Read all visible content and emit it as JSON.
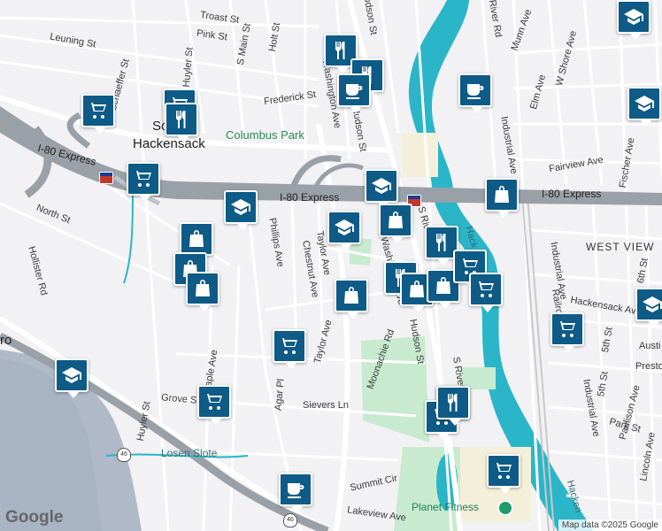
{
  "map": {
    "attribution": "Map data ©2025 Google",
    "logo": "Google",
    "colors": {
      "water": "#2ab6c8",
      "park": "#c8ebcf",
      "road": "#ffffff",
      "highway": "#9aa0a8",
      "land": "#f2f1f4",
      "poi": "#0d5b86"
    }
  },
  "labels": {
    "troast": "Troast St",
    "pink": "Pink St",
    "holt": "Holt St",
    "smain": "S Main St",
    "leuning": "Leuning St",
    "frederick": "Frederick St",
    "columbus": "Columbus Park",
    "south_hack_1": "Sou",
    "south_hack_2": "Hackensack",
    "i80_left": "I-80 Express",
    "i80_mid": "I-80 Express",
    "i80_right": "I-80 Express",
    "north": "North St",
    "hollister": "Hollister Rd",
    "phillips": "Phillips Ave",
    "chestnut": "Chestnut Ave",
    "taylor": "Taylor Ave",
    "taylor2": "Taylor Ave",
    "washington": "Washington Ave",
    "washington2": "Washington Ave",
    "hudson": "Hudson St",
    "hudson2": "Hudson St",
    "moonachie": "Moonachie Rd",
    "sriver": "S River",
    "sriver2": "S River",
    "huyler": "Huyler St",
    "huyler2": "Huyler St",
    "maple": "aple Ave",
    "grove": "Grove S",
    "agar": "Agar Pl",
    "sievers": "Sievers Ln",
    "losen": "Losen Slote",
    "summit": "Summit Cir",
    "lakeview": "Lakeview Ave",
    "planet": "Planet Fitness",
    "riverrd": "River Rd",
    "munn": "Munn Ave",
    "wshore": "W Shore Ave",
    "elm": "Elm Ave",
    "industrial": "Industrial Ave",
    "industrial2": "Industrial Ave",
    "industrial3": "Industrial Ave",
    "fairview": "Fairview Ave",
    "fischer": "Fischer Ave",
    "westview": "WEST VIEW",
    "hackensack_ave": "Hackensack Ave",
    "railroad": "Railro",
    "fifth1": "5th St",
    "fifth2": "5th St",
    "sixth": "6th St",
    "austin": "Austi",
    "preston": "Presto",
    "paulison": "Paulison Ave",
    "park": "Park St",
    "lincoln": "Lincoln Ave",
    "hack_river": "Hack",
    "hack_river2": "Hacken",
    "hs_left": "Schaeffer St",
    "ro": "ro",
    "i80a": "80",
    "i80b": "80",
    "us46a": "46",
    "us46b": "46"
  },
  "pois": [
    {
      "type": "restaurant",
      "icon": "fork-knife-icon"
    },
    {
      "type": "restaurant",
      "icon": "fork-knife-icon"
    },
    {
      "type": "cafe",
      "icon": "coffee-cup-icon"
    },
    {
      "type": "cafe",
      "icon": "coffee-cup-icon"
    },
    {
      "type": "school",
      "icon": "graduation-cap-icon"
    },
    {
      "type": "grocery",
      "icon": "shopping-cart-icon"
    },
    {
      "type": "grocery",
      "icon": "shopping-cart-icon"
    },
    {
      "type": "restaurant",
      "icon": "fork-knife-icon"
    },
    {
      "type": "school",
      "icon": "graduation-cap-icon"
    },
    {
      "type": "grocery",
      "icon": "shopping-cart-icon"
    },
    {
      "type": "school",
      "icon": "graduation-cap-icon"
    },
    {
      "type": "school",
      "icon": "graduation-cap-icon"
    },
    {
      "type": "shopping",
      "icon": "shopping-bag-icon"
    },
    {
      "type": "shopping",
      "icon": "shopping-bag-icon"
    },
    {
      "type": "restaurant",
      "icon": "fork-knife-icon"
    },
    {
      "type": "shopping",
      "icon": "shopping-bag-icon"
    },
    {
      "type": "shopping",
      "icon": "shopping-bag-icon"
    },
    {
      "type": "shopping",
      "icon": "shopping-bag-icon"
    },
    {
      "type": "shopping",
      "icon": "shopping-bag-icon"
    },
    {
      "type": "restaurant",
      "icon": "fork-knife-icon"
    },
    {
      "type": "shopping",
      "icon": "shopping-bag-icon"
    },
    {
      "type": "shopping",
      "icon": "shopping-bag-icon"
    },
    {
      "type": "grocery",
      "icon": "shopping-cart-icon"
    },
    {
      "type": "grocery",
      "icon": "shopping-cart-icon"
    },
    {
      "type": "grocery",
      "icon": "shopping-cart-icon"
    },
    {
      "type": "school",
      "icon": "graduation-cap-icon"
    },
    {
      "type": "grocery",
      "icon": "shopping-cart-icon"
    },
    {
      "type": "grocery",
      "icon": "shopping-cart-icon"
    },
    {
      "type": "grocery",
      "icon": "shopping-cart-icon"
    },
    {
      "type": "restaurant",
      "icon": "fork-knife-icon"
    },
    {
      "type": "grocery",
      "icon": "shopping-cart-icon"
    },
    {
      "type": "cafe",
      "icon": "coffee-cup-icon"
    },
    {
      "type": "grocery",
      "icon": "shopping-cart-icon"
    },
    {
      "type": "school",
      "icon": "graduation-cap-icon"
    },
    {
      "type": "school",
      "icon": "graduation-cap-icon"
    }
  ]
}
